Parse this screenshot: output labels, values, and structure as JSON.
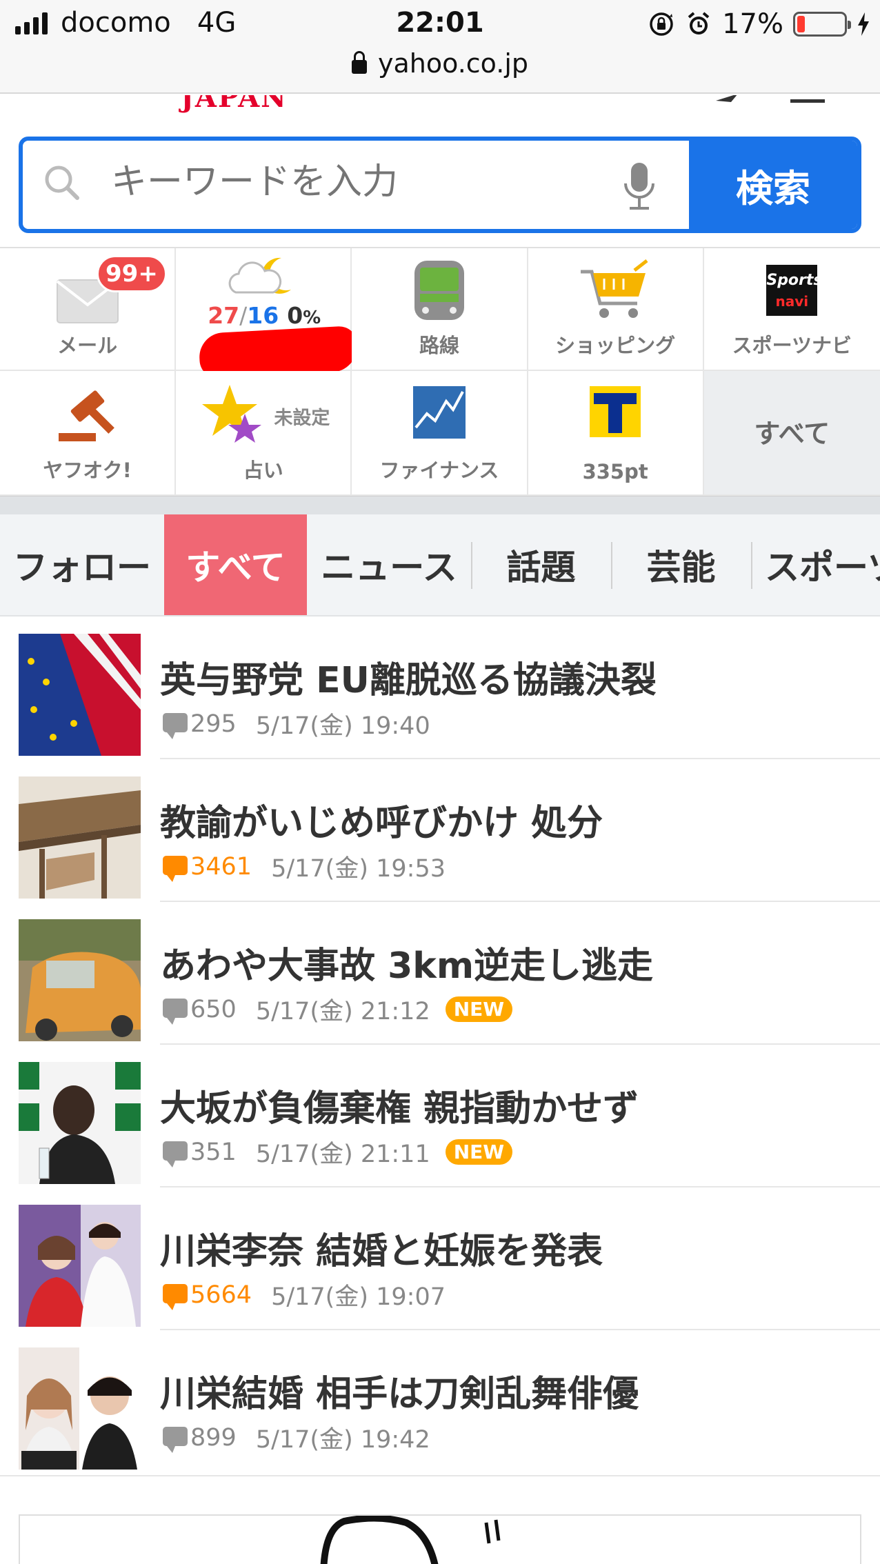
{
  "status_bar": {
    "carrier": "docomo",
    "network": "4G",
    "time": "22:01",
    "battery_percent": "17%",
    "battery_level": 0.17,
    "url": "yahoo.co.jp",
    "icons": [
      "signal-icon",
      "rotation-lock-icon",
      "alarm-icon",
      "battery-icon",
      "charging-icon",
      "lock-icon"
    ]
  },
  "header": {
    "logo_text": "JAPAN"
  },
  "search": {
    "placeholder": "キーワードを入力",
    "button_label": "検索"
  },
  "services": {
    "mail": {
      "label": "メール",
      "badge": "99+"
    },
    "weather": {
      "high": "27",
      "sep": "/",
      "low": "16",
      "precip": "0",
      "precip_unit": "%"
    },
    "route": {
      "label": "路線"
    },
    "shopping": {
      "label": "ショッピング"
    },
    "sportsnavi": {
      "label": "スポーツナビ",
      "logo_top": "Sports",
      "logo_bottom": "navi"
    },
    "auction": {
      "label": "ヤフオク!"
    },
    "fortune": {
      "label": "占い",
      "status": "未設定"
    },
    "finance": {
      "label": "ファイナンス"
    },
    "tpoint": {
      "label": "335pt"
    },
    "all": {
      "label": "すべて"
    }
  },
  "tabs": [
    "フォロー",
    "すべて",
    "ニュース",
    "話題",
    "芸能",
    "スポーツ"
  ],
  "active_tab": 1,
  "news": [
    {
      "title": "英与野党 EU離脱巡る協議決裂",
      "comments": "295",
      "date": "5/17(金) 19:40",
      "hot": false,
      "new": ""
    },
    {
      "title": "教諭がいじめ呼びかけ 処分",
      "comments": "3461",
      "date": "5/17(金) 19:53",
      "hot": true,
      "new": ""
    },
    {
      "title": "あわや大事故 3km逆走し逃走",
      "comments": "650",
      "date": "5/17(金) 21:12",
      "hot": false,
      "new": "NEW"
    },
    {
      "title": "大坂が負傷棄権 親指動かせず",
      "comments": "351",
      "date": "5/17(金) 21:11",
      "hot": false,
      "new": "NEW"
    },
    {
      "title": "川栄李奈 結婚と妊娠を発表",
      "comments": "5664",
      "date": "5/17(金) 19:07",
      "hot": true,
      "new": ""
    },
    {
      "title": "川栄結婚 相手は刀剣乱舞俳優",
      "comments": "899",
      "date": "5/17(金) 19:42",
      "hot": false,
      "new": ""
    }
  ],
  "colors": {
    "accent_blue": "#1a73e8",
    "tab_active": "#f06774",
    "hot_orange": "#ff8a00",
    "new_badge": "#ffa800",
    "badge_red": "#ef4b4b"
  }
}
